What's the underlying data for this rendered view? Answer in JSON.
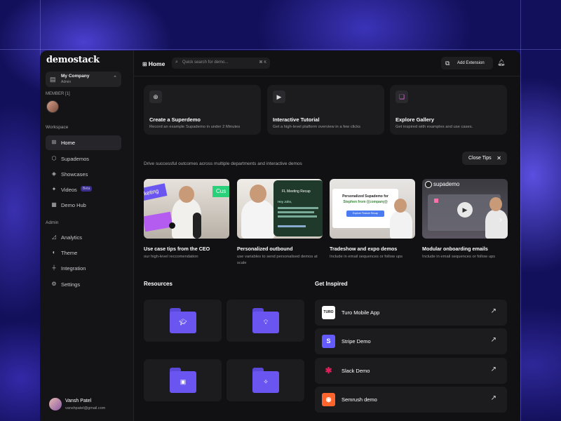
{
  "sidebar": {
    "logo": "demostack",
    "company": {
      "name": "My Company",
      "role": "Admin"
    },
    "member_label": "MEMBER [1]",
    "workspace_label": "Workspace",
    "workspace_items": [
      {
        "label": "Home",
        "icon": "home-grid-icon"
      },
      {
        "label": "Supademos",
        "icon": "cube-icon"
      },
      {
        "label": "Showcases",
        "icon": "layers-icon"
      },
      {
        "label": "Videos",
        "icon": "sparkle-icon",
        "badge": "Beta"
      },
      {
        "label": "Demo Hub",
        "icon": "grid-icon"
      }
    ],
    "admin_label": "Admin",
    "admin_items": [
      {
        "label": "Analytics",
        "icon": "chart-icon"
      },
      {
        "label": "Theme",
        "icon": "palette-icon"
      },
      {
        "label": "Integration",
        "icon": "plug-icon"
      },
      {
        "label": "Settings",
        "icon": "gear-icon"
      }
    ],
    "user": {
      "name": "Vansh Patel",
      "email": "vanshpatel@gmail.com"
    }
  },
  "topbar": {
    "title": "Home",
    "search_placeholder": "Quick search for demo...",
    "search_shortcut": "⌘ K",
    "add_extension": "Add Extension"
  },
  "quick_cards": [
    {
      "title": "Create a Superdemo",
      "sub": "Record an example Supademo in under 2 Minutes",
      "icon": "folder-plus-icon"
    },
    {
      "title": "Interactive Tutorial",
      "sub": "Get a high-level platform overview in a few clicks",
      "icon": "play-screen-icon"
    },
    {
      "title": "Explore Gallery",
      "sub": "Get inspired with examples and use cases.",
      "icon": "gallery-icon"
    }
  ],
  "tips": {
    "description": "Drive successful outcomes across multiple departments and interactive demos",
    "close_label": "Close Tips"
  },
  "videos": [
    {
      "title": "Use case tips from the CEO",
      "sub": "our high-level reccomendation"
    },
    {
      "title": "Personalized outbound",
      "sub": "use variables to send personalised demos at scale"
    },
    {
      "title": "Tradeshow and expo demos",
      "sub": "Include in email sequences or follow ups"
    },
    {
      "title": "Modular onboarding emails",
      "sub": "Include in email sequences or follow ups"
    }
  ],
  "thumb_text": {
    "v1_tag1": "keting",
    "v1_tag2": "Cus",
    "v2_heading": "FL Meeting Recap",
    "v2_body": "Hey John,",
    "v3_heading": "Personalized Supademo for",
    "v3_name": "Stephen from {{company}}",
    "v3_button": "Explore Feature Recap",
    "v4_brand": "supademo"
  },
  "resources_title": "Resources",
  "resources": [
    {
      "icon": "graduation-cap-icon"
    },
    {
      "icon": "lightbulb-icon"
    },
    {
      "icon": "video-icon"
    },
    {
      "icon": "magic-wand-icon"
    }
  ],
  "inspired_title": "Get Inspired",
  "inspired": [
    {
      "label": "Turo Mobile App",
      "logo": "turo-logo",
      "logo_text": "TURO",
      "bg": "#ffffff",
      "fg": "#111111"
    },
    {
      "label": "Stripe Demo",
      "logo": "stripe-logo",
      "logo_text": "S",
      "bg": "#635bff",
      "fg": "#ffffff"
    },
    {
      "label": "Slack Demo",
      "logo": "slack-logo",
      "logo_text": "✱",
      "bg": "transparent",
      "fg": "#e01e5a"
    },
    {
      "label": "Semrush demo",
      "logo": "semrush-logo",
      "logo_text": "◉",
      "bg": "#ff642d",
      "fg": "#ffffff"
    }
  ],
  "colors": {
    "accent": "#6a55f0",
    "background": "#111113",
    "card": "#1c1c1f"
  }
}
